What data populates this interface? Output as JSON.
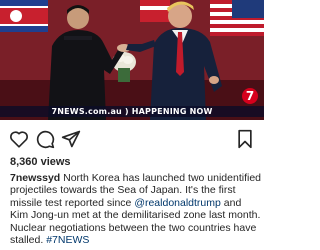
{
  "video": {
    "banner": "7NEWS.com.au ) HAPPENING NOW",
    "logo": "7",
    "colors": {
      "banner_bg": "#0a0c28",
      "logo_red": "#d6001c"
    }
  },
  "actions": {
    "like_icon": "heart-icon",
    "comment_icon": "comment-icon",
    "share_icon": "send-icon",
    "save_icon": "bookmark-icon"
  },
  "post": {
    "views": "8,360 views",
    "username": "7newssyd",
    "caption_part1": " North Korea has launched two unidentified projectiles towards the Sea of Japan. It's the first missile test reported since ",
    "mention1": "@realdonaldtrump",
    "caption_part2": " and Kim Jong-un met at the demilitarised zone last month. Nuclear negotiations between the two countries have stalled. ",
    "hashtag": "#7NEWS"
  },
  "colors": {
    "link": "#00376b",
    "text": "#262626"
  }
}
